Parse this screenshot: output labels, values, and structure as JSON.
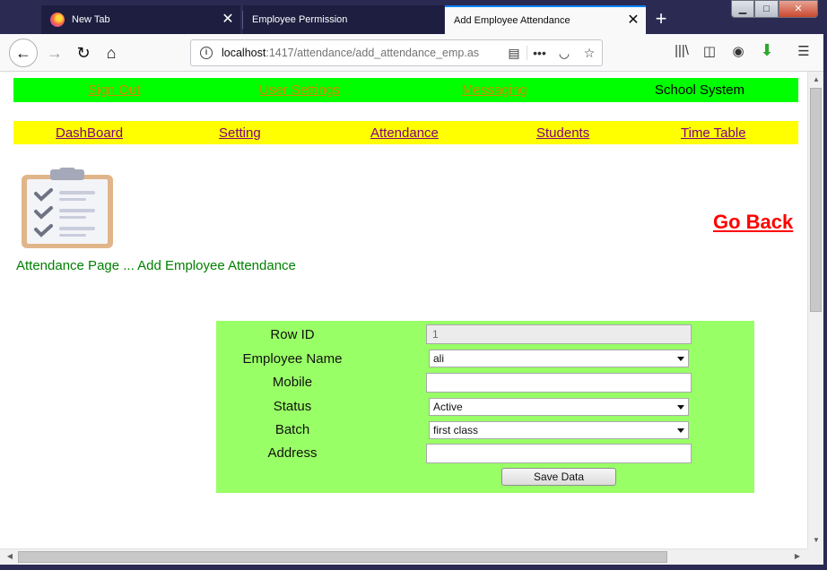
{
  "browser": {
    "tabs": [
      {
        "label": "New Tab"
      },
      {
        "label": "Employee Permission"
      },
      {
        "label": "Add Employee Attendance"
      }
    ],
    "url_host": "localhost",
    "url_path": ":1417/attendance/add_attendance_emp.as",
    "window_buttons": {
      "minimize": "▁",
      "maximize": "□",
      "close": "✕"
    }
  },
  "top_menu": {
    "sign_out": "Sign Out",
    "user_settings": "User Settings",
    "messaging": "Messaging",
    "app_name": "School System"
  },
  "main_menu": {
    "dashboard": "DashBoard",
    "setting": "Setting",
    "attendance": "Attendance",
    "students": "Students",
    "time_table": "Time Table"
  },
  "page": {
    "caption": "Attendance Page ... Add Employee Attendance",
    "go_back": "Go Back"
  },
  "form": {
    "row_id_label": "Row ID",
    "row_id_value": "1",
    "employee_name_label": "Employee Name",
    "employee_name_value": "ali",
    "mobile_label": "Mobile",
    "mobile_value": "",
    "status_label": "Status",
    "status_value": "Active",
    "batch_label": "Batch",
    "batch_value": "first class",
    "address_label": "Address",
    "address_value": "",
    "save_label": "Save Data"
  },
  "colors": {
    "top_menu_bg": "#00ff00",
    "main_menu_bg": "#ffff00",
    "form_bg": "#99ff66",
    "go_back": "#ff0000",
    "caption": "#008000"
  }
}
